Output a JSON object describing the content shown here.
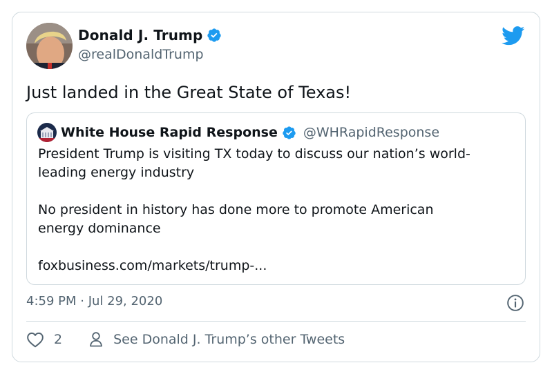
{
  "author": {
    "name": "Donald J. Trump",
    "handle": "@realDonaldTrump"
  },
  "tweet": {
    "text": "Just landed in the Great State of Texas!",
    "timestamp": "4:59 PM · Jul 29, 2020"
  },
  "quote": {
    "name": "White House Rapid Response",
    "handle": "@WHRapidResponse",
    "line1": "President Trump is visiting TX today to discuss our nation’s world-",
    "line2": "leading energy industry",
    "line3": "No president in history has done more to promote American",
    "line4": "energy dominance",
    "link": "foxbusiness.com/markets/trump-..."
  },
  "footer": {
    "like_count": "2",
    "other_tweets": "See Donald J. Trump’s other Tweets"
  },
  "colors": {
    "brand": "#1d9bf0",
    "text": "#0f1419",
    "secondary": "#536471",
    "border": "#cfd9de"
  },
  "icons": [
    "avatar",
    "verified-badge-icon",
    "twitter-bird-icon",
    "info-icon",
    "heart-icon",
    "person-icon"
  ]
}
